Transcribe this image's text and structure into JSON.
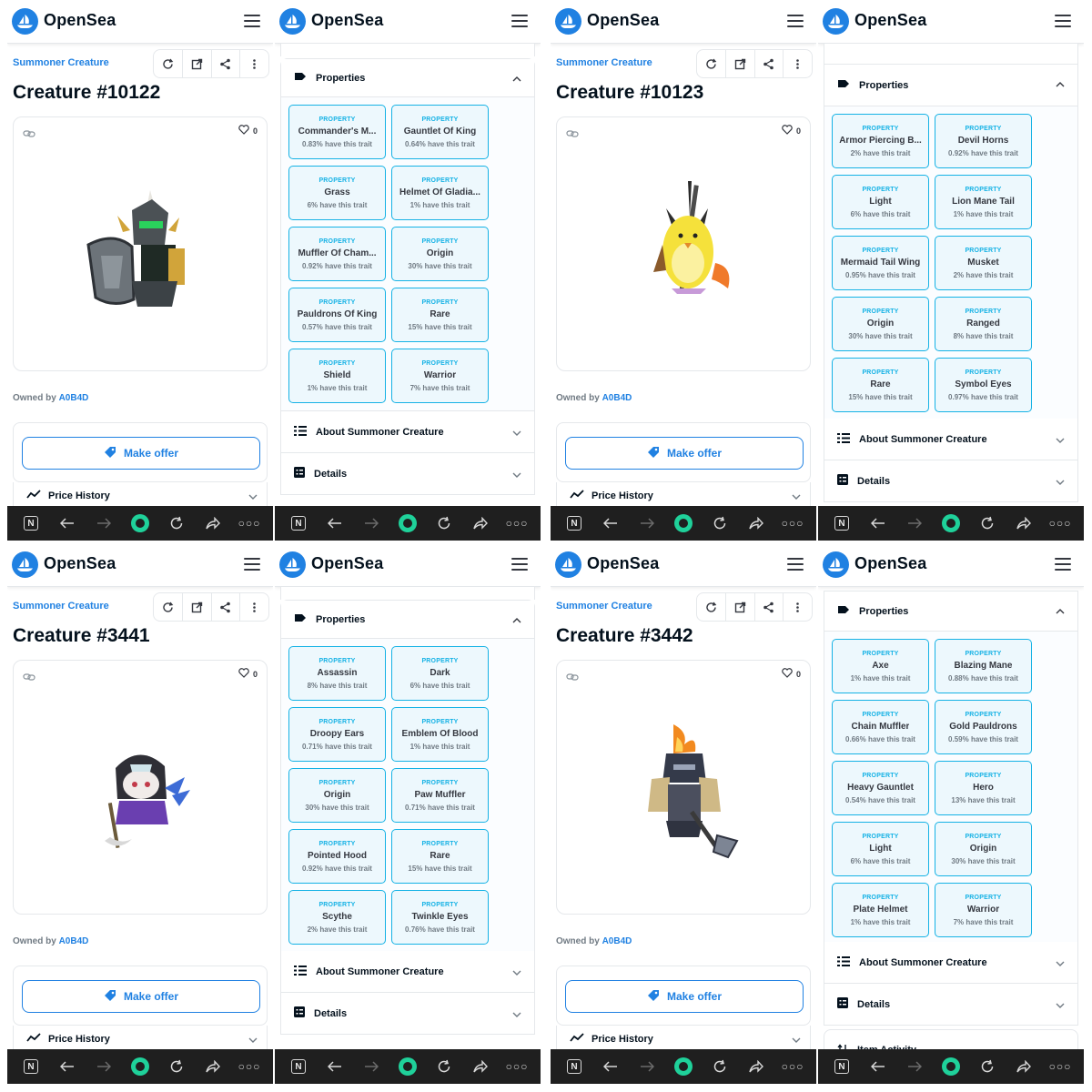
{
  "brand": "OpenSea",
  "collection": "Summoner Creature",
  "owned_prefix": "Owned by",
  "owner": "A0B4D",
  "like_count": "0",
  "make_offer": "Make offer",
  "price_history": "Price History",
  "properties_title": "Properties",
  "about": "About Summoner Creature",
  "details": "Details",
  "item_activity": "Item Activity",
  "property_label": "PROPERTY",
  "colors": {
    "accent": "#2081e2",
    "trait": "#15b2e5",
    "navbar": "#1f1f1f",
    "record": "#1fd19a"
  },
  "nav_icons": [
    "notion-icon",
    "back-arrow-icon",
    "forward-arrow-icon",
    "record-icon",
    "refresh-icon",
    "share-icon",
    "more-icon"
  ],
  "items": [
    {
      "title": "Creature #10122",
      "traits": [
        {
          "value": "Commander's M...",
          "rarity": "0.83% have this trait"
        },
        {
          "value": "Gauntlet Of King",
          "rarity": "0.64% have this trait"
        },
        {
          "value": "Grass",
          "rarity": "6% have this trait"
        },
        {
          "value": "Helmet Of Gladia...",
          "rarity": "1% have this trait"
        },
        {
          "value": "Muffler Of Cham...",
          "rarity": "0.92% have this trait"
        },
        {
          "value": "Origin",
          "rarity": "30% have this trait"
        },
        {
          "value": "Pauldrons Of King",
          "rarity": "0.57% have this trait"
        },
        {
          "value": "Rare",
          "rarity": "15% have this trait"
        },
        {
          "value": "Shield",
          "rarity": "1% have this trait"
        },
        {
          "value": "Warrior",
          "rarity": "7% have this trait"
        }
      ]
    },
    {
      "title": "Creature #10123",
      "traits": [
        {
          "value": "Armor Piercing B...",
          "rarity": "2% have this trait"
        },
        {
          "value": "Devil Horns",
          "rarity": "0.92% have this trait"
        },
        {
          "value": "Light",
          "rarity": "6% have this trait"
        },
        {
          "value": "Lion Mane Tail",
          "rarity": "1% have this trait"
        },
        {
          "value": "Mermaid Tail Wing",
          "rarity": "0.95% have this trait"
        },
        {
          "value": "Musket",
          "rarity": "2% have this trait"
        },
        {
          "value": "Origin",
          "rarity": "30% have this trait"
        },
        {
          "value": "Ranged",
          "rarity": "8% have this trait"
        },
        {
          "value": "Rare",
          "rarity": "15% have this trait"
        },
        {
          "value": "Symbol Eyes",
          "rarity": "0.97% have this trait"
        }
      ]
    },
    {
      "title": "Creature #3441",
      "traits": [
        {
          "value": "Assassin",
          "rarity": "8% have this trait"
        },
        {
          "value": "Dark",
          "rarity": "6% have this trait"
        },
        {
          "value": "Droopy Ears",
          "rarity": "0.71% have this trait"
        },
        {
          "value": "Emblem Of Blood",
          "rarity": "1% have this trait"
        },
        {
          "value": "Origin",
          "rarity": "30% have this trait"
        },
        {
          "value": "Paw Muffler",
          "rarity": "0.71% have this trait"
        },
        {
          "value": "Pointed Hood",
          "rarity": "0.92% have this trait"
        },
        {
          "value": "Rare",
          "rarity": "15% have this trait"
        },
        {
          "value": "Scythe",
          "rarity": "2% have this trait"
        },
        {
          "value": "Twinkle Eyes",
          "rarity": "0.76% have this trait"
        }
      ]
    },
    {
      "title": "Creature #3442",
      "traits": [
        {
          "value": "Axe",
          "rarity": "1% have this trait"
        },
        {
          "value": "Blazing Mane",
          "rarity": "0.88% have this trait"
        },
        {
          "value": "Chain Muffler",
          "rarity": "0.66% have this trait"
        },
        {
          "value": "Gold Pauldrons",
          "rarity": "0.59% have this trait"
        },
        {
          "value": "Heavy Gauntlet",
          "rarity": "0.54% have this trait"
        },
        {
          "value": "Hero",
          "rarity": "13% have this trait"
        },
        {
          "value": "Light",
          "rarity": "6% have this trait"
        },
        {
          "value": "Origin",
          "rarity": "30% have this trait"
        },
        {
          "value": "Plate Helmet",
          "rarity": "1% have this trait"
        },
        {
          "value": "Warrior",
          "rarity": "7% have this trait"
        }
      ]
    }
  ]
}
